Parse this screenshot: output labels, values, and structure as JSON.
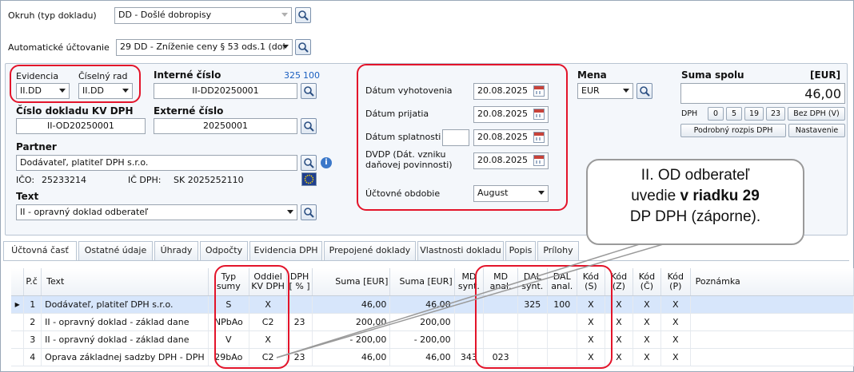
{
  "okruh": {
    "label": "Okruh (typ dokladu)",
    "value": "DD - Došlé dobropisy"
  },
  "auto": {
    "label": "Automatické účtovanie",
    "value": "29 DD - Zníženie  ceny § 53 ods.1 (dol"
  },
  "evidencia": {
    "label": "Evidencia",
    "value": "II.DD"
  },
  "ciselny_rad": {
    "label": "Číselný rad",
    "value": "II.DD"
  },
  "interne": {
    "label": "Interné číslo",
    "value": "II-DD20250001",
    "n1": "325",
    "n2": "100"
  },
  "cislo_kv": {
    "label": "Číslo dokladu KV DPH",
    "value": "II-OD20250001"
  },
  "externe": {
    "label": "Externé číslo",
    "value": "20250001"
  },
  "partner": {
    "label": "Partner",
    "value": "Dodávateľ, platiteľ DPH s.r.o.",
    "ico_label": "IČO:",
    "ico": "25233214",
    "icdph_label": "IČ DPH:",
    "icdph": "SK 2025252110"
  },
  "text": {
    "label": "Text",
    "value": "II - opravný doklad odberateľ"
  },
  "dates": {
    "vyhotovenia": {
      "label": "Dátum vyhotovenia",
      "value": "20.08.2025"
    },
    "prijatia": {
      "label": "Dátum prijatia",
      "value": "20.08.2025"
    },
    "splatnosti": {
      "label": "Dátum splatnosti",
      "value": "20.08.2025"
    },
    "dvdp": {
      "label1": "DVDP (Dát. vzniku",
      "label2": "daňovej povinnosti)",
      "value": "20.08.2025"
    },
    "obdobie": {
      "label": "Účtovné obdobie",
      "value": "August"
    }
  },
  "mena": {
    "label": "Mena",
    "value": "EUR"
  },
  "suma": {
    "label": "Suma spolu",
    "currency": "[EUR]",
    "value": "46,00",
    "dph_label": "DPH",
    "b0": "0",
    "b5": "5",
    "b19": "19",
    "b23": "23",
    "bez": "Bez DPH (V)",
    "rozpis": "Podrobný rozpis DPH",
    "nastavenie": "Nastavenie"
  },
  "tabs": [
    "Účtovná časť",
    "Ostatné údaje",
    "Úhrady",
    "Odpočty",
    "Evidencia DPH",
    "Prepojené doklady",
    "Vlastnosti dokladu",
    "Popis",
    "Prílohy"
  ],
  "grid": {
    "headers": {
      "pc": "P.č",
      "text": "Text",
      "typ1": "Typ",
      "typ2": "sumy",
      "oddiel1": "Oddiel",
      "oddiel2": "KV DPH",
      "dph1": "DPH",
      "dph2": "[ % ]",
      "suma1": "Suma [EUR]",
      "suma2": "Suma [EUR]",
      "mds1": "MD",
      "mds2": "synt.",
      "mda1": "MD",
      "mda2": "anal.",
      "dals1": "DAL",
      "dals2": "synt.",
      "dala1": "DAL",
      "dala2": "anal.",
      "ks1": "Kód",
      "ks2": "(S)",
      "kz1": "Kód",
      "kz2": "(Z)",
      "kc1": "Kód",
      "kc2": "(Č)",
      "kp1": "Kód",
      "kp2": "(P)",
      "pozn": "Poznámka"
    },
    "rows": [
      {
        "pc": "1",
        "text": "Dodávateľ, platiteľ DPH s.r.o.",
        "typ": "S",
        "oddiel": "X",
        "dph": "",
        "suma1": "46,00",
        "suma2": "46,00",
        "mds": "",
        "mda": "",
        "dals": "325",
        "dala": "100",
        "ks": "X",
        "kz": "X",
        "kc": "X",
        "kp": "X"
      },
      {
        "pc": "2",
        "text": "II - opravný doklad - základ dane",
        "typ": "NPbAo",
        "oddiel": "C2",
        "dph": "23",
        "suma1": "200,00",
        "suma2": "200,00",
        "mds": "",
        "mda": "",
        "dals": "",
        "dala": "",
        "ks": "X",
        "kz": "X",
        "kc": "X",
        "kp": "X"
      },
      {
        "pc": "3",
        "text": "II - opravný doklad - základ dane",
        "typ": "V",
        "oddiel": "X",
        "dph": "",
        "suma1": "- 200,00",
        "suma2": "- 200,00",
        "mds": "",
        "mda": "",
        "dals": "",
        "dala": "",
        "ks": "X",
        "kz": "X",
        "kc": "X",
        "kp": "X"
      },
      {
        "pc": "4",
        "text": "Oprava základnej sadzby DPH - DPH",
        "typ": "29bAo",
        "oddiel": "C2",
        "dph": "23",
        "suma1": "46,00",
        "suma2": "46,00",
        "mds": "343",
        "mda": "023",
        "dals": "",
        "dala": "",
        "ks": "X",
        "kz": "X",
        "kc": "X",
        "kp": "X"
      }
    ]
  },
  "callout": {
    "line1": "II. OD odberateľ",
    "line2a": "uvedie ",
    "line2b": "v riadku 29",
    "line3": "DP DPH (záporne)."
  }
}
